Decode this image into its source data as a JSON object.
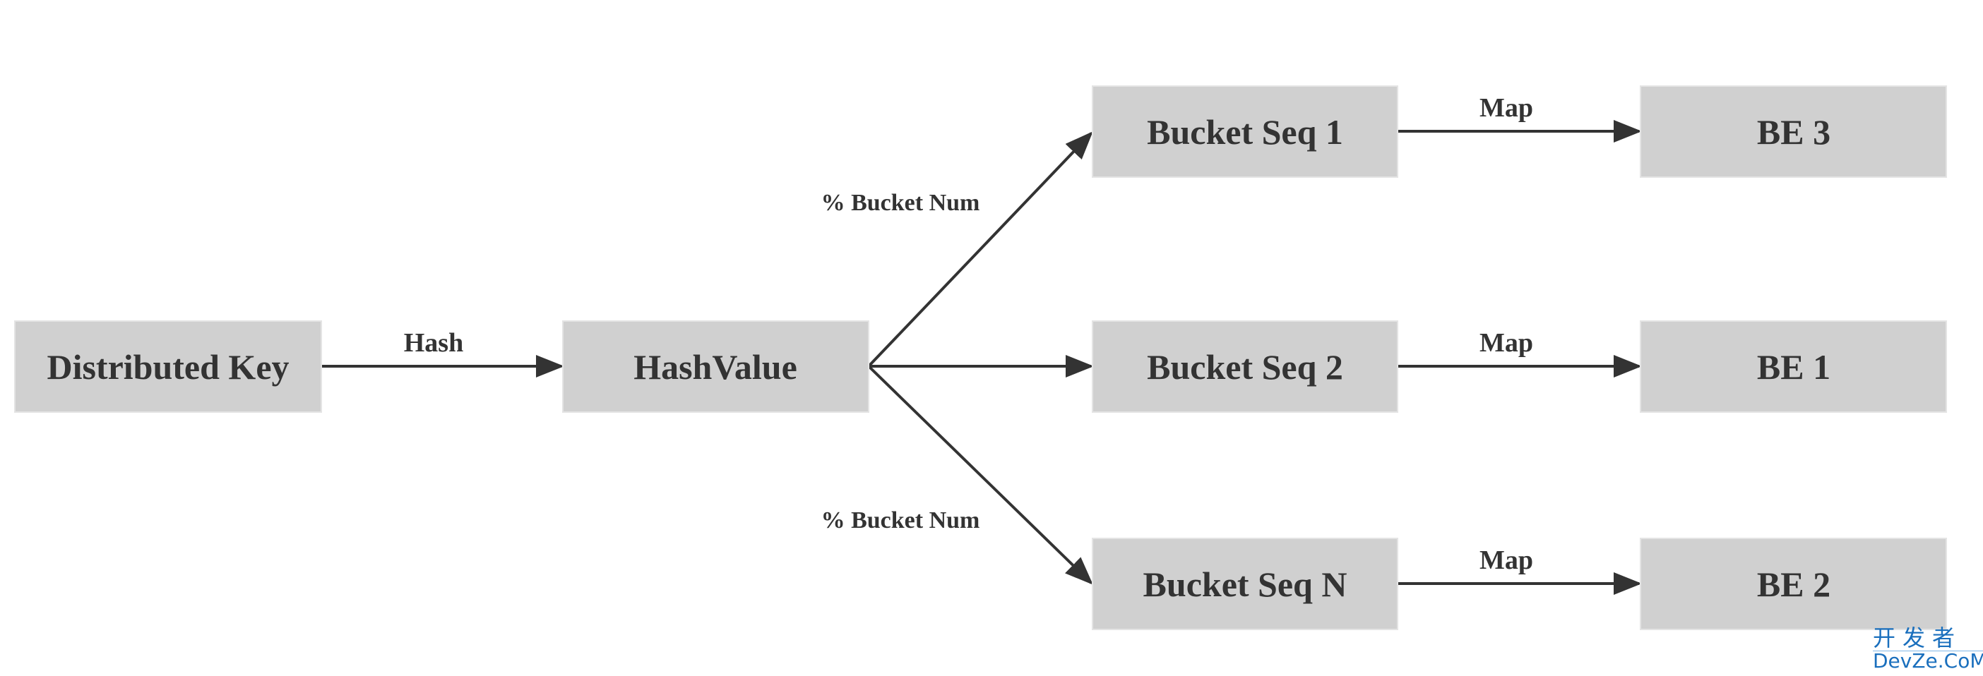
{
  "nodes": {
    "distributed_key": "Distributed Key",
    "hash_value": "HashValue",
    "bucket_seq_1": "Bucket Seq 1",
    "bucket_seq_2": "Bucket Seq 2",
    "bucket_seq_n": "Bucket Seq N",
    "be_3": "BE 3",
    "be_1": "BE 1",
    "be_2": "BE 2"
  },
  "edges": {
    "hash": "Hash",
    "bucket_num_top": "% Bucket Num",
    "bucket_num_bottom": "% Bucket Num",
    "map_1": "Map",
    "map_2": "Map",
    "map_n": "Map"
  },
  "colors": {
    "node_fill": "#d0d0d0",
    "text": "#333333",
    "watermark": "#1a6fbd"
  },
  "watermark": {
    "cn": "开发者",
    "en": "DevZe.CoM"
  }
}
